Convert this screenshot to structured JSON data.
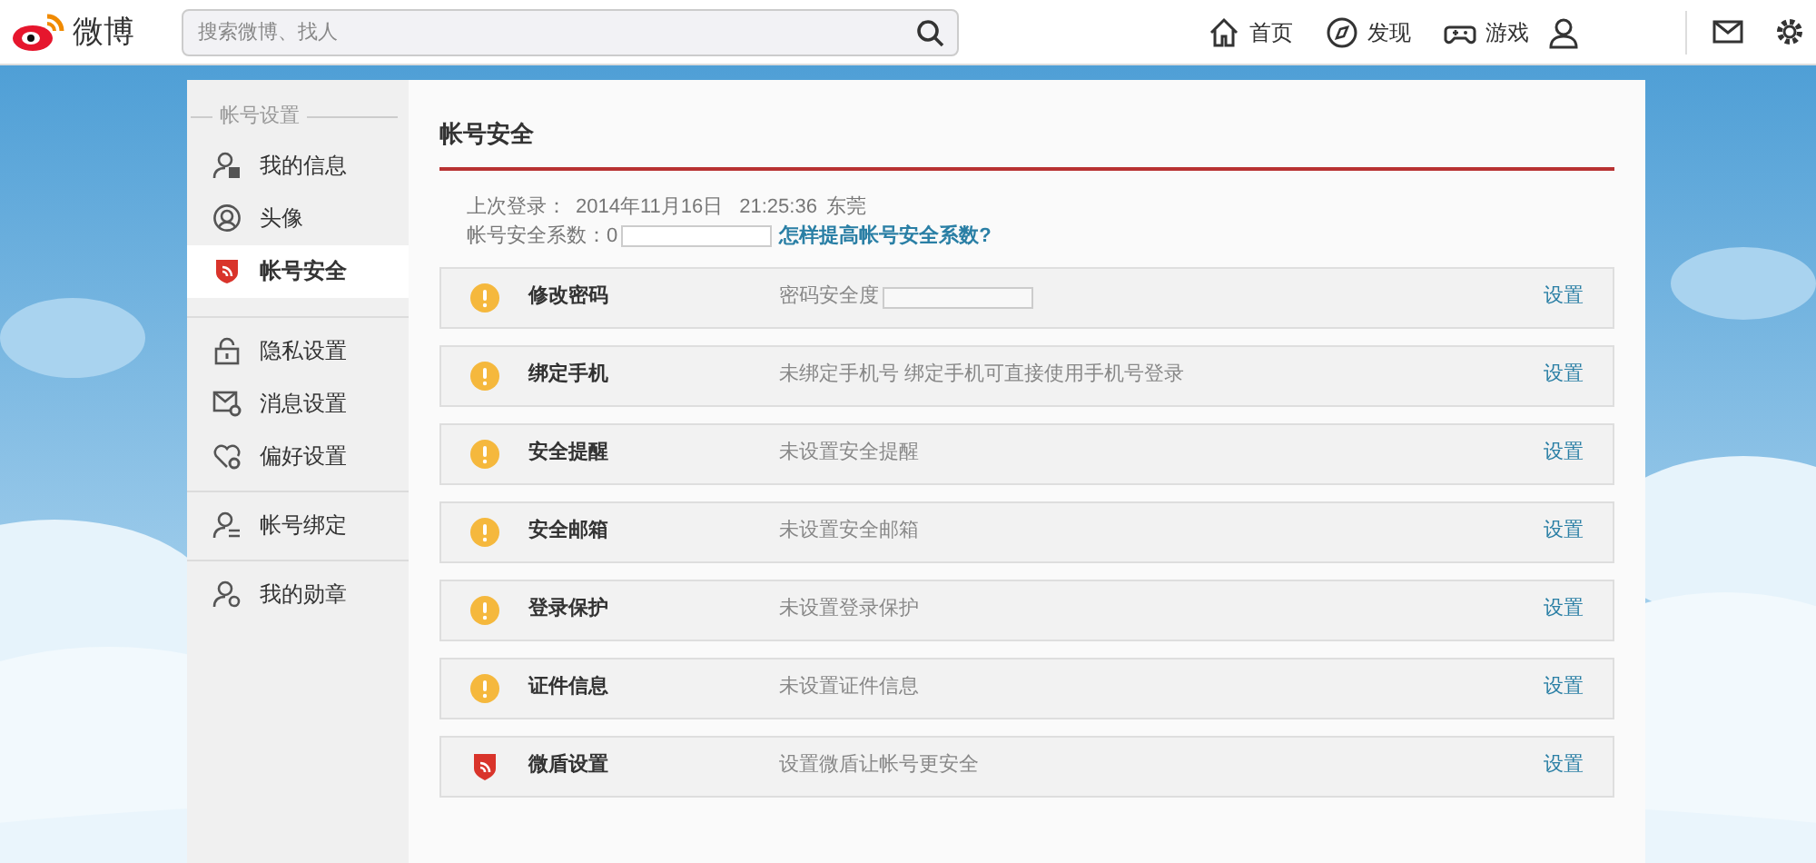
{
  "header": {
    "logo": "微博",
    "search": {
      "placeholder": "搜索微博、找人"
    },
    "nav": [
      {
        "label": "首页"
      },
      {
        "label": "发现"
      },
      {
        "label": "游戏"
      }
    ]
  },
  "sidebar": {
    "group_label": "帐号设置",
    "groups": [
      [
        {
          "label": "我的信息",
          "selected": false
        },
        {
          "label": "头像",
          "selected": false
        },
        {
          "label": "帐号安全",
          "selected": true
        }
      ],
      [
        {
          "label": "隐私设置",
          "selected": false
        },
        {
          "label": "消息设置",
          "selected": false
        },
        {
          "label": "偏好设置",
          "selected": false
        }
      ],
      [
        {
          "label": "帐号绑定",
          "selected": false
        }
      ],
      [
        {
          "label": "我的勋章",
          "selected": false
        }
      ]
    ]
  },
  "content": {
    "title": "帐号安全",
    "last_login_label": "上次登录：",
    "last_login_date": "2014年11月16日",
    "last_login_time": "21:25:36",
    "last_login_place": "东莞",
    "score_label": "帐号安全系数：0",
    "score_link": "怎样提高帐号安全系数?",
    "rows": [
      {
        "kind": "warning",
        "name": "修改密码",
        "desc": "密码安全度",
        "strength_meter": true,
        "action": "设置"
      },
      {
        "kind": "warning",
        "name": "绑定手机",
        "desc": "未绑定手机号 绑定手机可直接使用手机号登录",
        "strength_meter": false,
        "action": "设置"
      },
      {
        "kind": "warning",
        "name": "安全提醒",
        "desc": "未设置安全提醒",
        "strength_meter": false,
        "action": "设置"
      },
      {
        "kind": "warning",
        "name": "安全邮箱",
        "desc": "未设置安全邮箱",
        "strength_meter": false,
        "action": "设置"
      },
      {
        "kind": "warning",
        "name": "登录保护",
        "desc": "未设置登录保护",
        "strength_meter": false,
        "action": "设置"
      },
      {
        "kind": "warning",
        "name": "证件信息",
        "desc": "未设置证件信息",
        "strength_meter": false,
        "action": "设置"
      },
      {
        "kind": "shield",
        "name": "微盾设置",
        "desc": "设置微盾让帐号更安全",
        "strength_meter": false,
        "action": "设置"
      }
    ]
  }
}
